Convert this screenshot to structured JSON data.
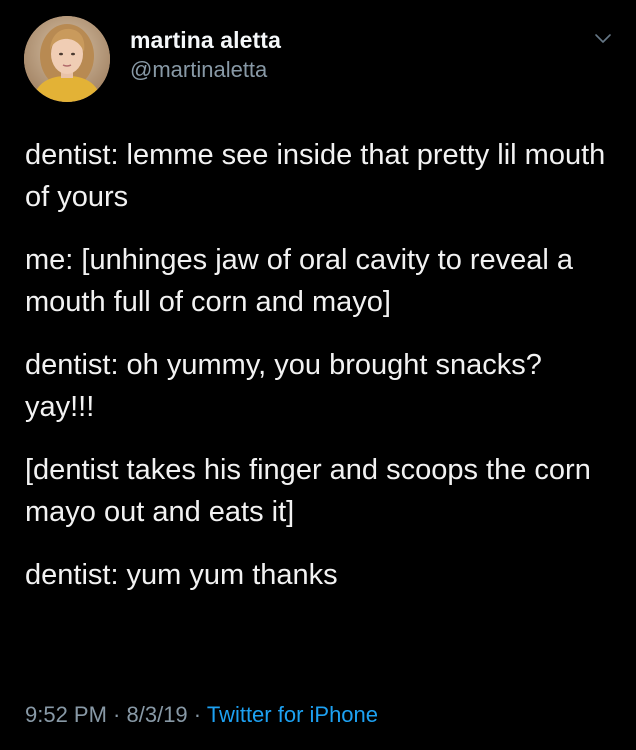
{
  "user": {
    "display_name": "martina aletta",
    "handle": "@martinaletta",
    "avatar_icon": "profile-photo"
  },
  "menu": {
    "icon": "chevron-down-icon"
  },
  "tweet": {
    "paragraphs": [
      "dentist: lemme see inside that pretty lil mouth of yours",
      "me: [unhinges jaw of oral cavity to reveal a mouth full of corn and mayo]",
      "dentist: oh yummy, you brought snacks? yay!!!",
      "[dentist takes his finger and scoops the corn mayo out and eats it]",
      "dentist: yum yum thanks"
    ]
  },
  "meta": {
    "time": "9:52 PM",
    "separator1": " · ",
    "date": "8/3/19",
    "separator2": " · ",
    "source": "Twitter for iPhone"
  },
  "colors": {
    "background": "#000000",
    "text": "#f2f2f2",
    "secondary": "#8899a6",
    "link": "#1da1f2"
  }
}
